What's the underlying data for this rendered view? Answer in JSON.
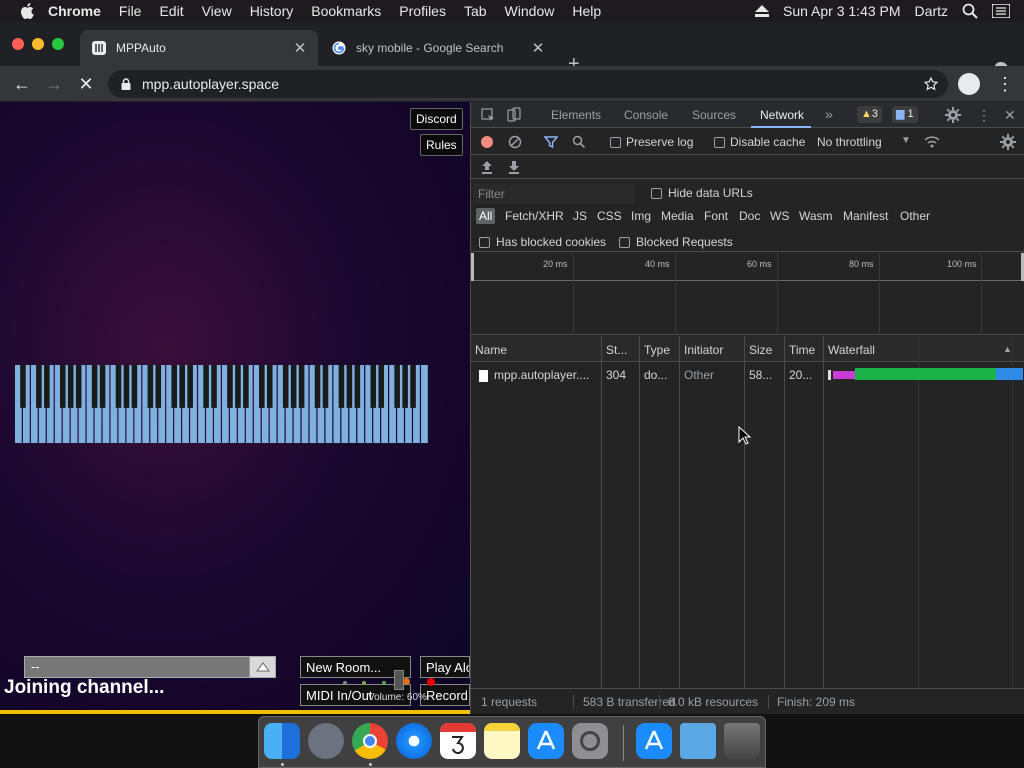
{
  "menubar": {
    "app": "Chrome",
    "items": [
      "File",
      "Edit",
      "View",
      "History",
      "Bookmarks",
      "Profiles",
      "Tab",
      "Window",
      "Help"
    ],
    "datetime": "Sun Apr 3  1:43 PM",
    "user": "Dartz"
  },
  "tabs": [
    {
      "title": "MPPAuto",
      "close": "✕"
    },
    {
      "title": "sky mobile - Google Search",
      "close": "✕"
    }
  ],
  "toolbar": {
    "url": "mpp.autoplayer.space"
  },
  "page": {
    "discord": "Discord",
    "rules": "Rules",
    "chat_value": "--",
    "status": "Joining channel...",
    "new_room": "New Room...",
    "midi": "MIDI In/Out",
    "play": "Play Alo",
    "record": "Record",
    "volume": "Volume: 60%"
  },
  "devtools": {
    "tabs": [
      "Elements",
      "Console",
      "Sources",
      "Network"
    ],
    "more": "»",
    "warnings": "3",
    "messages": "1",
    "preserve_log": "Preserve log",
    "disable_cache": "Disable cache",
    "throttling": "No throttling",
    "filter_placeholder": "Filter",
    "hide_data_urls": "Hide data URLs",
    "filter_types": [
      "All",
      "Fetch/XHR",
      "JS",
      "CSS",
      "Img",
      "Media",
      "Font",
      "Doc",
      "WS",
      "Wasm",
      "Manifest",
      "Other"
    ],
    "has_blocked_cookies": "Has blocked cookies",
    "blocked_requests": "Blocked Requests",
    "ticks": [
      "20 ms",
      "40 ms",
      "60 ms",
      "80 ms",
      "100 ms"
    ],
    "columns": [
      "Name",
      "St...",
      "Type",
      "Initiator",
      "Size",
      "Time",
      "Waterfall"
    ],
    "rows": [
      {
        "name": "mpp.autoplayer....",
        "status": "304",
        "type": "do...",
        "initiator": "Other",
        "size": "58...",
        "time": "20..."
      }
    ],
    "summary": {
      "requests": "1 requests",
      "transferred": "583 B transferred",
      "resources": "8.0 kB resources",
      "finish": "Finish: 209 ms"
    }
  },
  "colors": {
    "accent": "#8ab4f8",
    "record": "#f28b82",
    "waterfall_green": "#1ab34a",
    "waterfall_purple": "#c73dd6",
    "waterfall_blue": "#2f8be6"
  }
}
